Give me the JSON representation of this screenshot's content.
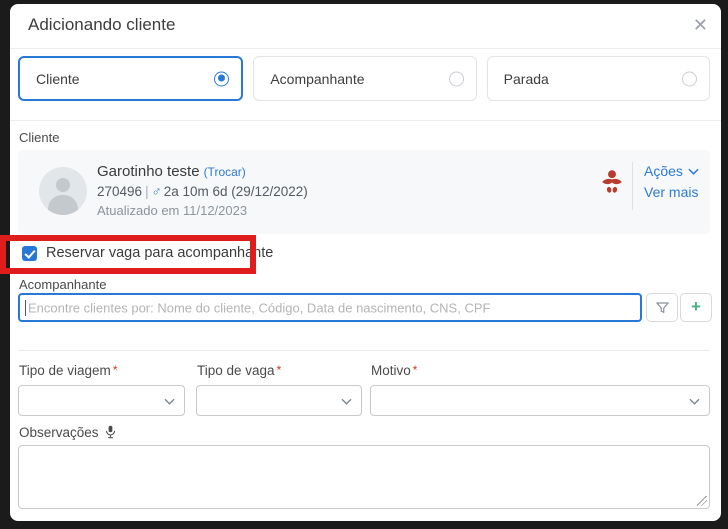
{
  "modal": {
    "title": "Adicionando cliente",
    "close_glyph": "✕"
  },
  "tabs": [
    {
      "label": "Cliente",
      "selected": true
    },
    {
      "label": "Acompanhante",
      "selected": false
    },
    {
      "label": "Parada",
      "selected": false
    }
  ],
  "client_section": {
    "label": "Cliente",
    "name": "Garotinho teste",
    "change_link": "(Trocar)",
    "code": "270496",
    "separator": "|",
    "gender_symbol": "♂",
    "age": "2a 10m 6d (29/12/2022)",
    "updated": "Atualizado em 11/12/2023",
    "actions_label": "Ações",
    "more_label": "Ver mais"
  },
  "reserve_checkbox": {
    "label": "Reservar vaga para acompanhante",
    "checked": true
  },
  "companion": {
    "label": "Acompanhante",
    "placeholder": "Encontre clientes por: Nome do cliente, Código, Data de nascimento, CNS, CPF",
    "add_glyph": "+"
  },
  "selects": [
    {
      "label": "Tipo de viagem",
      "required_mark": "*",
      "value": ""
    },
    {
      "label": "Tipo de vaga",
      "required_mark": "*",
      "value": ""
    },
    {
      "label": "Motivo",
      "required_mark": "*",
      "value": ""
    }
  ],
  "observations": {
    "label": "Observações",
    "value": ""
  },
  "icons": {
    "baby": "baby-red-indicator",
    "filter": "funnel",
    "microphone": "mic"
  },
  "colors": {
    "accent_blue": "#2878d8",
    "link_blue": "#2d7ad1",
    "annotation_red": "#df1d1d",
    "baby_icon_red": "#b93a2e",
    "add_green": "#47b181",
    "card_bg": "#f6f8fa",
    "backdrop": "#1b1b1b"
  }
}
